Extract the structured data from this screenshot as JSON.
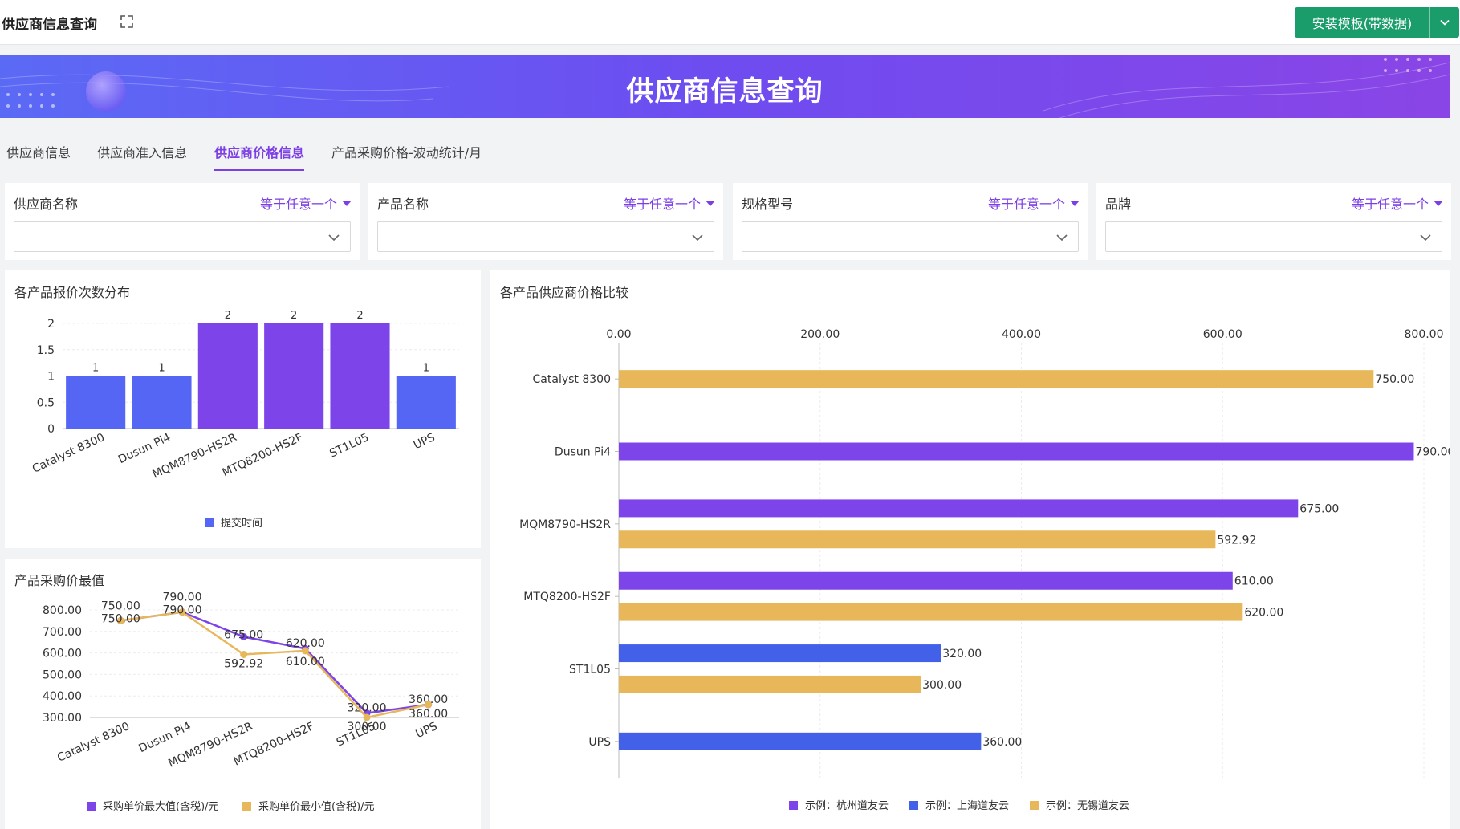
{
  "app": {
    "title": "供应商信息查询",
    "install_label": "安装模板(带数据)"
  },
  "banner": {
    "title": "供应商信息查询"
  },
  "tabs": [
    {
      "label": "供应商信息",
      "active": false
    },
    {
      "label": "供应商准入信息",
      "active": false
    },
    {
      "label": "供应商价格信息",
      "active": true
    },
    {
      "label": "产品采购价格-波动统计/月",
      "active": false
    }
  ],
  "filters": [
    {
      "label": "供应商名称",
      "operator": "等于任意一个",
      "value": ""
    },
    {
      "label": "产品名称",
      "operator": "等于任意一个",
      "value": ""
    },
    {
      "label": "规格型号",
      "operator": "等于任意一个",
      "value": ""
    },
    {
      "label": "品牌",
      "operator": "等于任意一个",
      "value": ""
    }
  ],
  "colors": {
    "accent": "#7b3fe4",
    "install": "#1a9c6b",
    "blue": "#5566f5",
    "purple": "#7d44ea",
    "gold": "#e8b75a",
    "darkblue": "#4360e8"
  },
  "chart_data": [
    {
      "type": "bar",
      "title": "各产品报价次数分布",
      "categories": [
        "Catalyst 8300",
        "Dusun Pi4",
        "MQM8790-HS2R",
        "MTQ8200-HS2F",
        "ST1L05",
        "UPS"
      ],
      "series": [
        {
          "name": "提交时间",
          "values": [
            1,
            1,
            2,
            2,
            2,
            1
          ]
        }
      ],
      "bar_colors": [
        "#5566f5",
        "#5566f5",
        "#7d44ea",
        "#7d44ea",
        "#7d44ea",
        "#5566f5"
      ],
      "y_ticks": [
        "0",
        "0.5",
        "1",
        "1.5",
        "2"
      ],
      "ylim": [
        0,
        2
      ],
      "legend": "bottom",
      "grid": true
    },
    {
      "type": "line",
      "title": "产品采购价最值",
      "categories": [
        "Catalyst 8300",
        "Dusun Pi4",
        "MQM8790-HS2R",
        "MTQ8200-HS2F",
        "ST1L05",
        "UPS"
      ],
      "series": [
        {
          "name": "采购单价最大值(含税)/元",
          "values": [
            750,
            790,
            675,
            620,
            320,
            360
          ],
          "labels": [
            "750.00",
            "790.00",
            "675.00",
            "620.00",
            "320.00",
            "360.00"
          ],
          "color": "#7d44ea"
        },
        {
          "name": "采购单价最小值(含税)/元",
          "values": [
            750,
            790,
            592.92,
            610,
            300,
            360
          ],
          "labels": [
            "750.00",
            "790.00",
            "592.92",
            "610.00",
            "300.00",
            "360.00"
          ],
          "color": "#e8b75a"
        }
      ],
      "y_ticks": [
        "300.00",
        "400.00",
        "500.00",
        "600.00",
        "700.00",
        "800.00"
      ],
      "ylim": [
        300,
        800
      ],
      "legend": "bottom",
      "grid": true
    },
    {
      "type": "bar",
      "orientation": "horizontal",
      "title": "各产品供应商价格比较",
      "categories": [
        "Catalyst 8300",
        "Dusun Pi4",
        "MQM8790-HS2R",
        "MTQ8200-HS2F",
        "ST1L05",
        "UPS"
      ],
      "series": [
        {
          "name": "示例：杭州道友云",
          "color": "#7d44ea",
          "values": [
            null,
            790,
            675,
            610,
            null,
            null
          ],
          "labels": [
            "",
            "790.00",
            "675.00",
            "610.00",
            "",
            ""
          ]
        },
        {
          "name": "示例：上海道友云",
          "color": "#4360e8",
          "values": [
            null,
            null,
            null,
            null,
            320,
            360
          ],
          "labels": [
            "",
            "",
            "",
            "",
            "320.00",
            "360.00"
          ]
        },
        {
          "name": "示例：无锡道友云",
          "color": "#e8b75a",
          "values": [
            750,
            null,
            592.92,
            620,
            300,
            null
          ],
          "labels": [
            "750.00",
            "",
            "592.92",
            "620.00",
            "300.00",
            ""
          ]
        }
      ],
      "x_ticks": [
        "0.00",
        "200.00",
        "400.00",
        "600.00",
        "800.00"
      ],
      "xlim": [
        0,
        800
      ],
      "axis_position": "top",
      "legend": "bottom",
      "grid": true
    }
  ]
}
